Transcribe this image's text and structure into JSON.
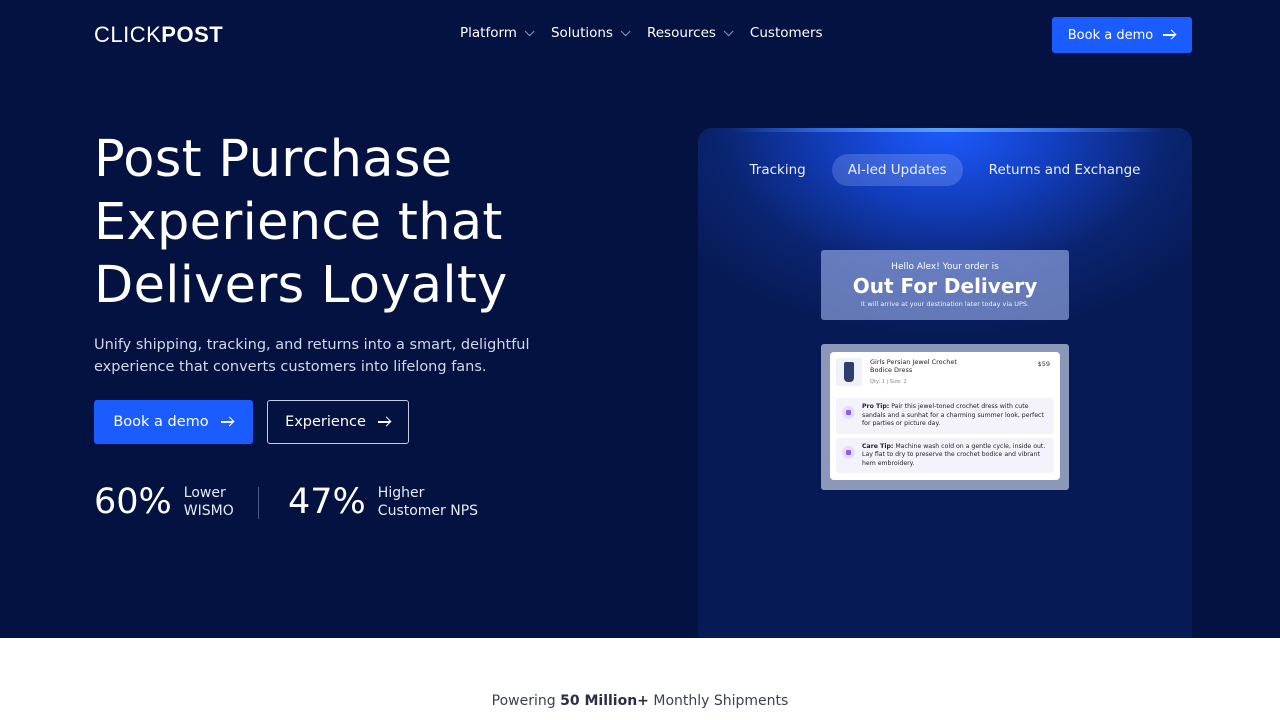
{
  "nav": {
    "logo_light": "CLICK",
    "logo_bold": "POST",
    "items": [
      {
        "label": "Platform"
      },
      {
        "label": "Solutions"
      },
      {
        "label": "Resources"
      },
      {
        "label": "Customers"
      }
    ],
    "cta_label": "Book a demo"
  },
  "hero": {
    "headline_1": "Post Purchase",
    "headline_2": "Experience that",
    "headline_3": "Delivers Loyalty",
    "subtext": "Unify shipping, tracking, and returns into a smart, delightful experience that converts customers into lifelong fans.",
    "primary_cta": "Book a demo",
    "secondary_cta": "Experience",
    "stats": [
      {
        "value": "60%",
        "label_1": "Lower",
        "label_2": "WISMO"
      },
      {
        "value": "47%",
        "label_1": "Higher",
        "label_2": "Customer NPS"
      }
    ]
  },
  "preview": {
    "tabs": [
      {
        "label": "Tracking"
      },
      {
        "label": "AI-led Updates"
      },
      {
        "label": "Returns and Exchange"
      }
    ],
    "active_tab": "AI-led Updates",
    "status": {
      "greeting": "Hello Alex! Your order is",
      "title": "Out For Delivery",
      "subtitle": "It will arrive at your destination later today via UPS."
    },
    "product": {
      "name_1": "Girls Persian Jewel Crochet",
      "name_2": "Bodice Dress",
      "meta": "Qty: 1   |   Size: 2",
      "price": "$59"
    },
    "tips": [
      {
        "title": "Pro Tip:",
        "text": "Pair this jewel-toned crochet dress with cute sandals and a sunhat for a charming summer look, perfect for parties or picture day."
      },
      {
        "title": "Care Tip:",
        "text": "Machine wash cold on a gentle cycle, inside out. Lay flat to dry to preserve the crochet bodice and vibrant hem embroidery."
      }
    ]
  },
  "footer": {
    "prefix": "Powering",
    "highlight": "50 Million+",
    "suffix": "Monthly Shipments"
  },
  "colors": {
    "hero_bg": "#031241",
    "accent": "#1b5cff"
  }
}
